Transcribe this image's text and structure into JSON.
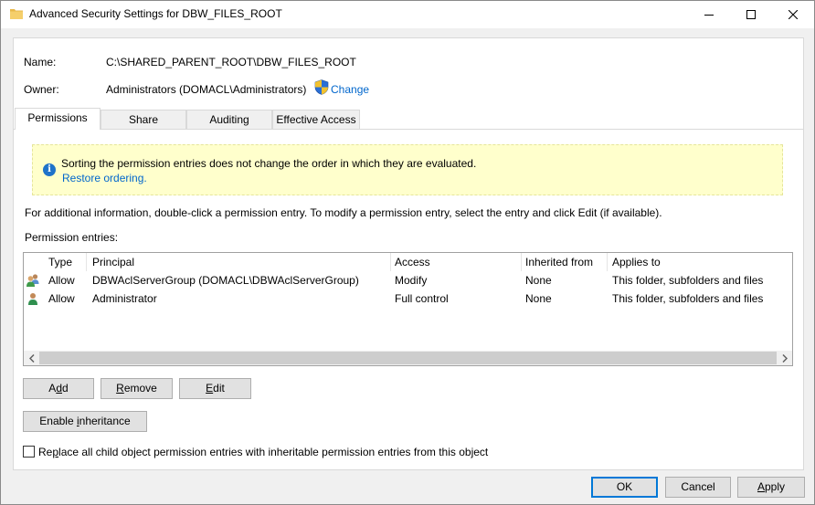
{
  "window": {
    "title": "Advanced Security Settings for DBW_FILES_ROOT"
  },
  "fields": {
    "name_label": "Name:",
    "name_value": "C:\\SHARED_PARENT_ROOT\\DBW_FILES_ROOT",
    "owner_label": "Owner:",
    "owner_value": "Administrators (DOMACL\\Administrators)",
    "change_link": "Change"
  },
  "tabs": [
    {
      "label": "Permissions",
      "active": true
    },
    {
      "label": "Share",
      "active": false
    },
    {
      "label": "Auditing",
      "active": false
    },
    {
      "label": "Effective Access",
      "active": false
    }
  ],
  "banner": {
    "message": "Sorting the permission entries does not change the order in which they are evaluated.",
    "link": "Restore ordering."
  },
  "instructions": "For additional information, double-click a permission entry. To modify a permission entry, select the entry and click Edit (if available).",
  "entries_label": "Permission entries:",
  "table": {
    "columns": [
      "Type",
      "Principal",
      "Access",
      "Inherited from",
      "Applies to"
    ],
    "rows": [
      {
        "icon": "user-group-icon",
        "type": "Allow",
        "principal": "DBWAclServerGroup (DOMACL\\DBWAclServerGroup)",
        "access": "Modify",
        "inherited": "None",
        "applies": "This folder, subfolders and files"
      },
      {
        "icon": "user-icon",
        "type": "Allow",
        "principal": "Administrator",
        "access": "Full control",
        "inherited": "None",
        "applies": "This folder, subfolders and files"
      }
    ]
  },
  "buttons": {
    "add_pre": "A",
    "add_u": "d",
    "add_post": "d",
    "remove_pre": "",
    "remove_u": "R",
    "remove_post": "emove",
    "edit_pre": "",
    "edit_u": "E",
    "edit_post": "dit",
    "inherit_pre": "Enable ",
    "inherit_u": "i",
    "inherit_post": "nheritance",
    "ok": "OK",
    "cancel": "Cancel",
    "apply_pre": "",
    "apply_u": "A",
    "apply_post": "pply"
  },
  "replace_pre": "Re",
  "replace_u": "p",
  "replace_post": "lace all child object permission entries with inheritable permission entries from this object",
  "colors": {
    "accent": "#0078d7",
    "link": "#0066cc",
    "banner_bg": "#ffffcc",
    "info_blue": "#1f73c9"
  }
}
